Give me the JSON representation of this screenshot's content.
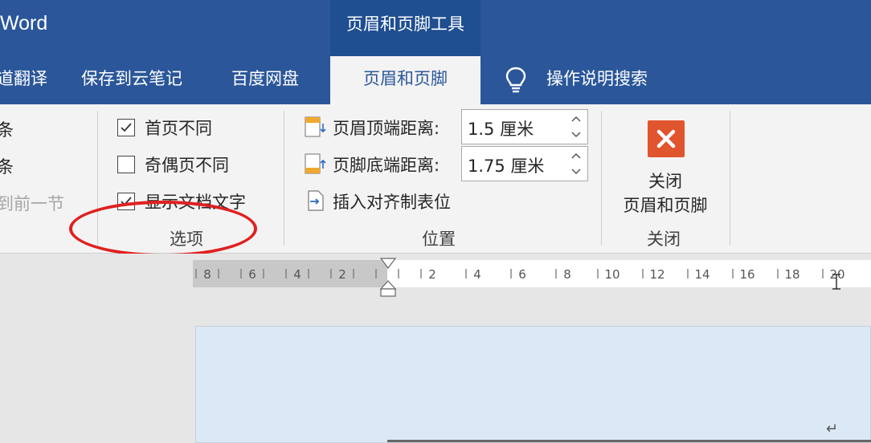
{
  "app": {
    "title": "Word"
  },
  "context_tab_group": {
    "label": "页眉和页脚工具"
  },
  "tabs": [
    {
      "label": "道翻译",
      "active": false
    },
    {
      "label": "保存到云笔记",
      "active": false
    },
    {
      "label": "百度网盘",
      "active": false
    },
    {
      "label": "页眉和页脚",
      "active": true
    },
    {
      "label": "操作说明搜索",
      "active": false
    }
  ],
  "ribbon": {
    "navigation": {
      "items": [
        {
          "label": "条",
          "enabled": true
        },
        {
          "label": "条",
          "enabled": true
        },
        {
          "label": "到前一节",
          "enabled": false
        }
      ]
    },
    "options": {
      "group_label": "选项",
      "checkboxes": [
        {
          "label": "首页不同",
          "checked": true
        },
        {
          "label": "奇偶页不同",
          "checked": false
        },
        {
          "label": "显示文档文字",
          "checked": true
        }
      ]
    },
    "position": {
      "group_label": "位置",
      "header_distance": {
        "label": "页眉顶端距离:",
        "value": "1.5 厘米"
      },
      "footer_distance": {
        "label": "页脚底端距离:",
        "value": "1.75 厘米"
      },
      "insert_align_tab": {
        "label": "插入对齐制表位"
      }
    },
    "close": {
      "group_label": "关闭",
      "button_line1": "关闭",
      "button_line2": "页眉和页脚"
    }
  },
  "ruler": {
    "left_labels": [
      "8",
      "6",
      "4",
      "2"
    ],
    "right_labels": [
      "2",
      "4",
      "6",
      "8",
      "10",
      "12",
      "14",
      "16",
      "18",
      "20"
    ]
  },
  "colors": {
    "title_bar": "#2b579a",
    "context_group": "#1f4e91",
    "ribbon_bg": "#f3f3f3",
    "close_icon": "#e0542e",
    "annotation": "#e02020"
  }
}
